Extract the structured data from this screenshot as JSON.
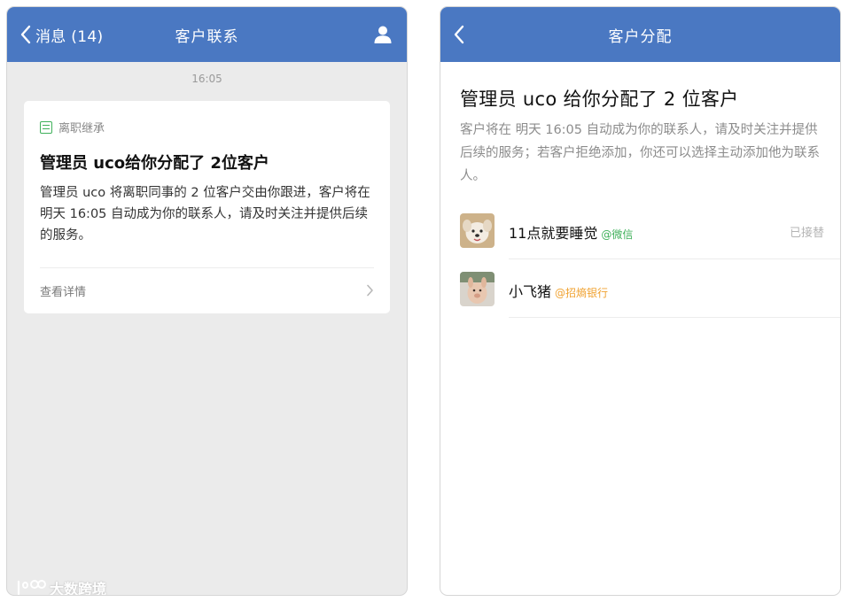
{
  "left_screen": {
    "nav": {
      "back_label": "消息 (14)",
      "title": "客户联系"
    },
    "time": "16:05",
    "card": {
      "tag": "离职继承",
      "title": "管理员 uco给你分配了 2位客户",
      "body": "管理员 uco 将离职同事的 2 位客户交由你跟进，客户将在 明天 16:05 自动成为你的联系人，请及时关注并提供后续的服务。",
      "link_label": "查看详情"
    }
  },
  "right_screen": {
    "nav": {
      "title": "客户分配"
    },
    "title": "管理员 uco 给你分配了 2 位客户",
    "description": "客户将在 明天 16:05 自动成为你的联系人，请及时关注并提供后续的服务；若客户拒绝添加，你还可以选择主动添加他为联系人。",
    "contacts": [
      {
        "name": "11点就要睡觉",
        "source": "@微信",
        "status": "已接替"
      },
      {
        "name": "小飞猪",
        "source": "@招熵银行",
        "status": ""
      }
    ]
  },
  "watermark": "大数跨境",
  "colors": {
    "nav_blue": "#4a78c2",
    "wechat_green": "#3fb05a",
    "corp_orange": "#f0a230"
  },
  "icons": {
    "back": "chevron-left-icon",
    "user": "user-icon",
    "tag": "transfer-icon",
    "more": "chevron-right-icon"
  }
}
